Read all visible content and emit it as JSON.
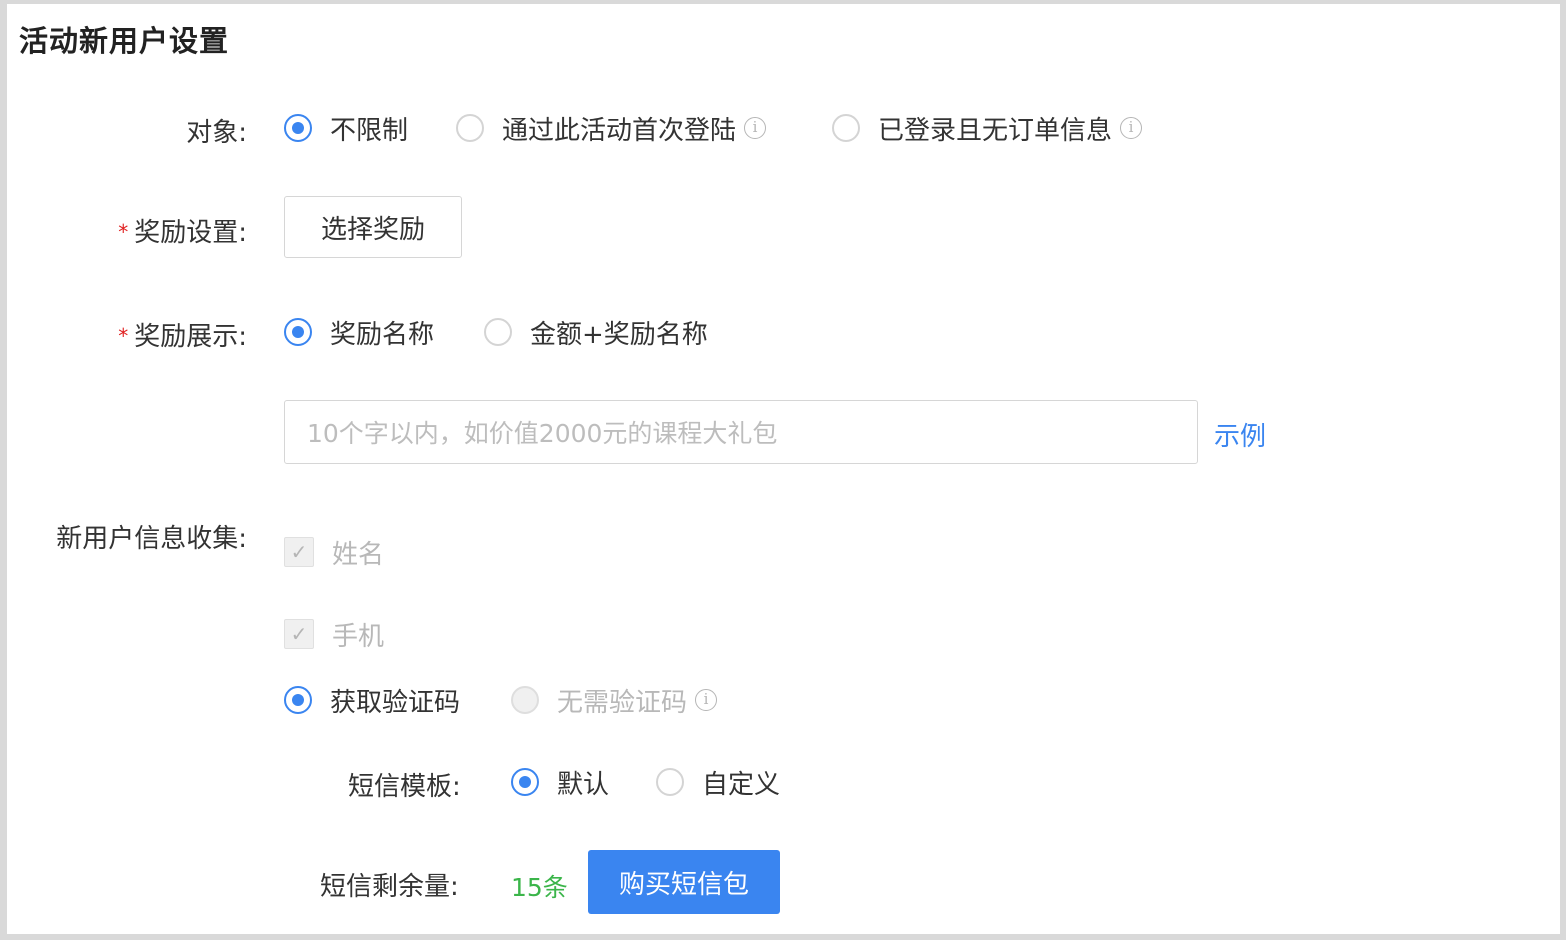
{
  "page_title": "活动新用户设置",
  "target": {
    "label": "对象:",
    "options": [
      {
        "label": "不限制",
        "checked": true
      },
      {
        "label": "通过此活动首次登陆",
        "checked": false,
        "info": true
      },
      {
        "label": "已登录且无订单信息",
        "checked": false,
        "info": true
      }
    ]
  },
  "reward_setting": {
    "required_mark": "*",
    "label": "奖励设置:",
    "button_label": "选择奖励"
  },
  "reward_display": {
    "required_mark": "*",
    "label": "奖励展示:",
    "options": [
      {
        "label": "奖励名称",
        "checked": true
      },
      {
        "label": "金额+奖励名称",
        "checked": false
      }
    ],
    "input_placeholder": "10个字以内，如价值2000元的课程大礼包",
    "example_link": "示例"
  },
  "info_collect": {
    "label": "新用户信息收集:",
    "checkboxes": [
      {
        "label": "姓名",
        "checked": true,
        "disabled": true
      },
      {
        "label": "手机",
        "checked": true,
        "disabled": true
      }
    ],
    "verify_options": [
      {
        "label": "获取验证码",
        "checked": true
      },
      {
        "label": "无需验证码",
        "checked": false,
        "disabled": true,
        "info": true
      }
    ]
  },
  "sms_template": {
    "label": "短信模板:",
    "options": [
      {
        "label": "默认",
        "checked": true
      },
      {
        "label": "自定义",
        "checked": false
      }
    ]
  },
  "sms_remaining": {
    "label": "短信剩余量:",
    "value": "15条",
    "buy_button": "购买短信包"
  },
  "colors": {
    "accent": "#3a85f0",
    "required": "#e02020",
    "remaining": "#3bb54a"
  }
}
